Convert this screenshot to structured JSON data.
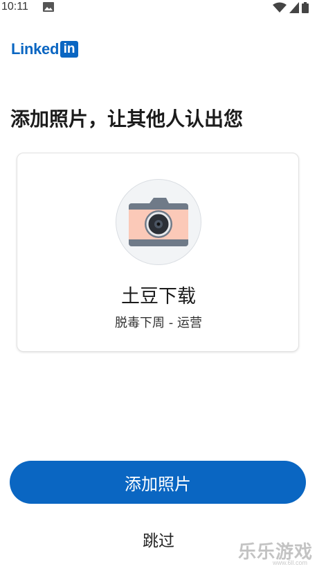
{
  "status": {
    "time": "10:11"
  },
  "logo": {
    "text": "Linked",
    "box": "in"
  },
  "heading": "添加照片，让其他人认出您",
  "card": {
    "name": "土豆下载",
    "subtitle": "脱毒下周 - 运营"
  },
  "buttons": {
    "add_photo": "添加照片",
    "skip": "跳过"
  },
  "watermark": {
    "main": "乐乐游戏",
    "sub": "www.6ll.com"
  },
  "colors": {
    "brand": "#0a66c2"
  }
}
